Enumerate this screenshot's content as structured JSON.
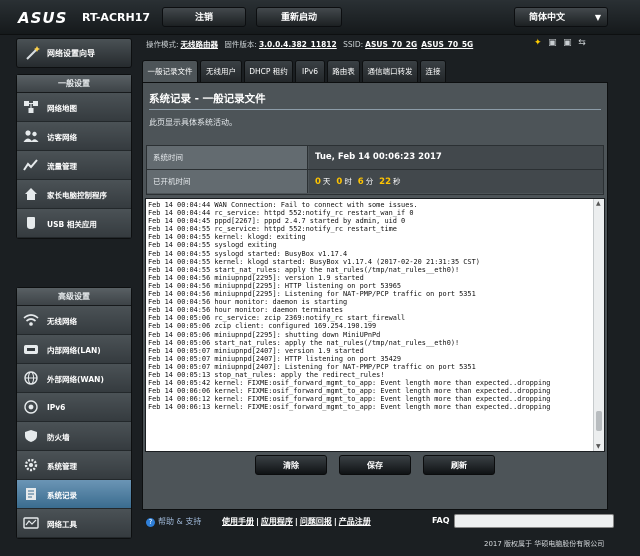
{
  "header": {
    "brand": "ASUS",
    "model": "RT-ACRH17",
    "logout_label": "注销",
    "reboot_label": "重新启动",
    "language": "简体中文"
  },
  "sidebar": {
    "quick_setup": "网络设置向导",
    "general_title": "一般设置",
    "general_items": [
      {
        "label": "网络地图",
        "icon": "network-map-icon"
      },
      {
        "label": "访客网络",
        "icon": "guest-network-icon"
      },
      {
        "label": "流量管理",
        "icon": "traffic-manager-icon"
      },
      {
        "label": "家长电脑控制程序",
        "icon": "parental-control-icon"
      },
      {
        "label": "USB 相关应用",
        "icon": "usb-app-icon"
      }
    ],
    "advanced_title": "高级设置",
    "advanced_items": [
      {
        "label": "无线网络",
        "icon": "wireless-icon"
      },
      {
        "label": "内部网络(LAN)",
        "icon": "lan-icon"
      },
      {
        "label": "外部网络(WAN)",
        "icon": "wan-icon"
      },
      {
        "label": "IPv6",
        "icon": "ipv6-icon"
      },
      {
        "label": "防火墙",
        "icon": "firewall-icon"
      },
      {
        "label": "系统管理",
        "icon": "administration-icon"
      },
      {
        "label": "系统记录",
        "icon": "system-log-icon"
      },
      {
        "label": "网络工具",
        "icon": "network-tools-icon"
      }
    ]
  },
  "status": {
    "mode_label": "操作模式:",
    "mode_value": "无线路由器",
    "firmware_label": "固件版本:",
    "firmware_value": "3.0.0.4.382_11812",
    "ssid_label": "SSID:",
    "ssid_2g": "ASUS_70_2G",
    "ssid_5g": "ASUS_70_5G"
  },
  "tabs": [
    "一般记录文件",
    "无线用户",
    "DHCP 租约",
    "IPv6",
    "路由表",
    "通信端口转发",
    "连接"
  ],
  "panel": {
    "title": "系统记录 - 一般记录文件",
    "description": "此页显示具体系统活动。",
    "system_time_label": "系统时间",
    "system_time_value": "Tue, Feb 14 00:06:23 2017",
    "uptime_label": "已开机时间",
    "uptime_days": "0",
    "uptime_days_unit": "天",
    "uptime_hours": "0",
    "uptime_hours_unit": "时",
    "uptime_minutes": "6",
    "uptime_minutes_unit": "分",
    "uptime_seconds": "22",
    "uptime_seconds_unit": "秒",
    "log_lines": [
      "Feb 14 00:04:44 WAN Connection: Fail to connect with some issues.",
      "Feb 14 00:04:44 rc_service: httpd 552:notify_rc restart_wan_if 0",
      "Feb 14 00:04:45 pppd[2267]: pppd 2.4.7 started by admin, uid 0",
      "Feb 14 00:04:55 rc_service: httpd 552:notify_rc restart_time",
      "Feb 14 00:04:55 kernel: klogd: exiting",
      "Feb 14 00:04:55 syslogd exiting",
      "Feb 14 00:04:55 syslogd started: BusyBox v1.17.4",
      "Feb 14 00:04:55 kernel: klogd started: BusyBox v1.17.4 (2017-02-20 21:31:35 CST)",
      "Feb 14 00:04:55 start_nat_rules: apply the nat_rules(/tmp/nat_rules__eth0)!",
      "Feb 14 00:04:56 miniupnpd[2295]: version 1.9 started",
      "Feb 14 00:04:56 miniupnpd[2295]: HTTP listening on port 53965",
      "Feb 14 00:04:56 miniupnpd[2295]: Listening for NAT-PMP/PCP traffic on port 5351",
      "Feb 14 00:04:56 hour monitor: daemon is starting",
      "Feb 14 00:04:56 hour monitor: daemon terminates",
      "Feb 14 00:05:06 rc_service: zcip 2369:notify_rc start_firewall",
      "Feb 14 00:05:06 zcip client: configured 169.254.190.199",
      "Feb 14 00:05:06 miniupnpd[2295]: shutting down MiniUPnPd",
      "Feb 14 00:05:06 start_nat_rules: apply the nat_rules(/tmp/nat_rules__eth0)!",
      "Feb 14 00:05:07 miniupnpd[2407]: version 1.9 started",
      "Feb 14 00:05:07 miniupnpd[2407]: HTTP listening on port 35429",
      "Feb 14 00:05:07 miniupnpd[2407]: Listening for NAT-PMP/PCP traffic on port 5351",
      "Feb 14 00:05:13 stop_nat_rules: apply the redirect_rules!",
      "Feb 14 00:05:42 kernel: FIXME:osif_forward_mgmt_to_app: Event length more than expected..dropping",
      "Feb 14 00:06:06 kernel: FIXME:osif_forward_mgmt_to_app: Event length more than expected..dropping",
      "Feb 14 00:06:12 kernel: FIXME:osif_forward_mgmt_to_app: Event length more than expected..dropping",
      "Feb 14 00:06:13 kernel: FIXME:osif_forward_mgmt_to_app: Event length more than expected..dropping"
    ],
    "clear_label": "清除",
    "save_label": "保存",
    "refresh_label": "刷新"
  },
  "footer": {
    "help_label": "帮助 & 支持",
    "links": [
      "使用手册",
      "应用程序",
      "问题回报",
      "产品注册"
    ],
    "faq_label": "FAQ",
    "copyright": "2017 版权属于 华硕电脑股份有限公司"
  }
}
